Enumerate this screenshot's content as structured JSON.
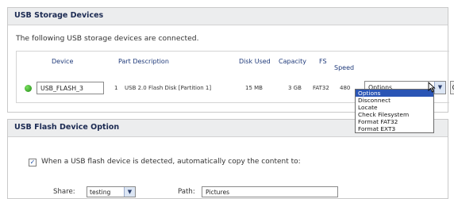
{
  "storage": {
    "title": "USB Storage Devices",
    "intro": "The following USB storage devices are connected.",
    "columns": {
      "device": "Device",
      "part": "Part Description",
      "disk_used": "Disk Used",
      "capacity": "Capacity",
      "fs": "FS",
      "speed": "Speed"
    },
    "device": {
      "name": "USB_FLASH_3",
      "index": "1",
      "part": "USB 2.0 Flash Disk [Partition 1]",
      "disk_used": "15 MB",
      "capacity": "3 GB",
      "fs": "FAT32",
      "speed": "480",
      "status_color": "#2f9a1e"
    },
    "action_select": {
      "value": "Options",
      "options": [
        "Options",
        "Disconnect",
        "Locate",
        "Check Filesystem",
        "Format FAT32",
        "Format EXT3"
      ]
    },
    "go_label": "Go"
  },
  "flash_option": {
    "title": "USB Flash Device Option",
    "auto_copy_checked": true,
    "auto_copy_label": "When a USB flash device is detected, automatically copy the content to:",
    "share_label": "Share:",
    "share_value": "testing",
    "path_label": "Path:",
    "path_value": "Pictures"
  }
}
